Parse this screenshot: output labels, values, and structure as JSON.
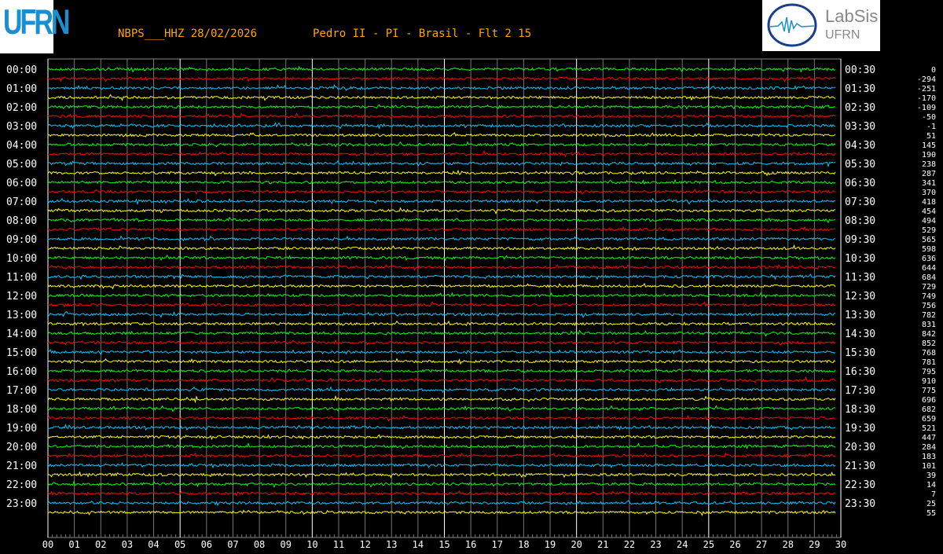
{
  "header": {
    "station": "NBPS___HHZ 28/02/2026",
    "location": "Pedro II - PI - Brasil - Flt 2 15",
    "logo_left": "UFRN",
    "logo_right": [
      "LabSis",
      "UFRN"
    ]
  },
  "chart_data": {
    "type": "line",
    "title": "NBPS___HHZ 28/02/2026",
    "xlabel": "",
    "ylabel": "",
    "x_ticks": [
      "00",
      "01",
      "02",
      "03",
      "04",
      "05",
      "06",
      "07",
      "08",
      "09",
      "10",
      "11",
      "12",
      "13",
      "14",
      "15",
      "16",
      "17",
      "18",
      "19",
      "20",
      "21",
      "22",
      "23",
      "24",
      "25",
      "26",
      "27",
      "28",
      "29",
      "30"
    ],
    "xlim": [
      0,
      30
    ],
    "left_labels": [
      "00:00",
      "01:00",
      "02:00",
      "03:00",
      "04:00",
      "05:00",
      "06:00",
      "07:00",
      "08:00",
      "09:00",
      "10:00",
      "11:00",
      "12:00",
      "13:00",
      "14:00",
      "15:00",
      "16:00",
      "17:00",
      "18:00",
      "19:00",
      "20:00",
      "21:00",
      "22:00",
      "23:00"
    ],
    "right_labels": [
      "00:30",
      "01:30",
      "02:30",
      "03:30",
      "04:30",
      "05:30",
      "06:30",
      "07:30",
      "08:30",
      "09:30",
      "10:30",
      "11:30",
      "12:30",
      "13:30",
      "14:30",
      "15:30",
      "16:30",
      "17:30",
      "18:30",
      "19:30",
      "20:30",
      "21:30",
      "22:30",
      "23:30"
    ],
    "offsets": [
      0,
      -294,
      -251,
      -170,
      -109,
      -50,
      -1,
      51,
      145,
      190,
      238,
      287,
      341,
      370,
      418,
      454,
      494,
      529,
      565,
      598,
      636,
      644,
      684,
      729,
      749,
      756,
      782,
      831,
      842,
      852,
      768,
      781,
      795,
      910,
      775,
      696,
      682,
      659,
      521,
      447,
      284,
      183,
      101,
      39,
      14,
      7,
      25,
      55
    ],
    "trace_colors": [
      "#00ff00",
      "#ff0000",
      "#00c8ff",
      "#ffff00"
    ],
    "grid": true
  }
}
